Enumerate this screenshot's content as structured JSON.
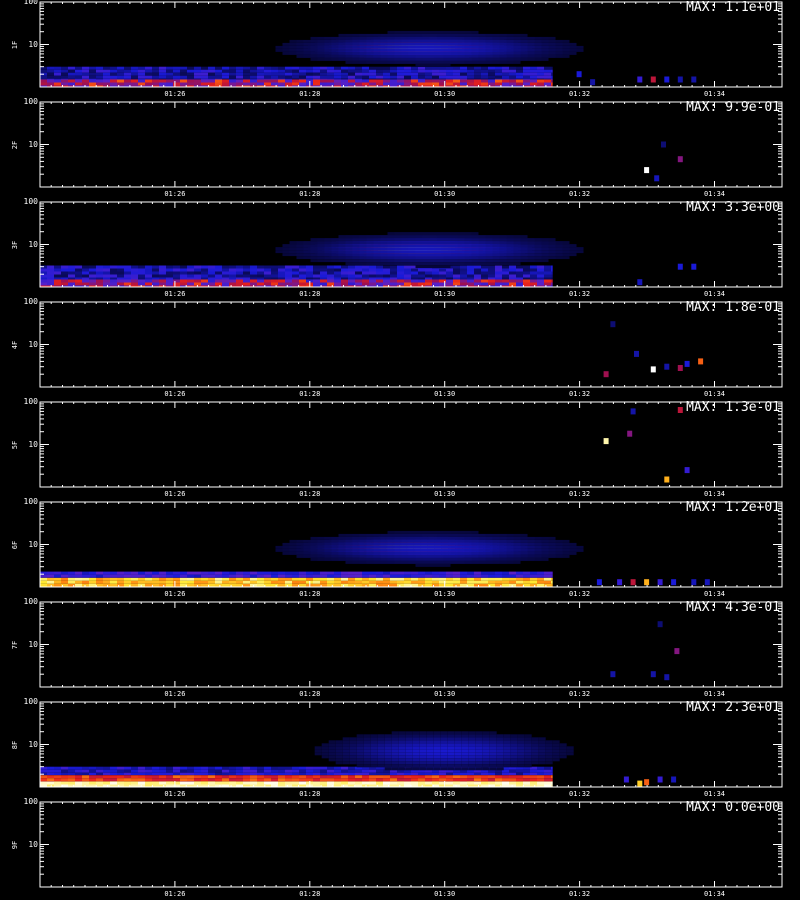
{
  "chart_data": {
    "type": "heatmap",
    "colormap": [
      "#000000",
      "#0a0a5a",
      "#1a1ad8",
      "#5a20c8",
      "#a01050",
      "#e8201a",
      "#ff8a10",
      "#ffe830",
      "#ffffff"
    ],
    "x_ticks": [
      "01:26",
      "01:28",
      "01:30",
      "01:32",
      "01:34"
    ],
    "x_range_minutes": [
      84.0,
      95.0
    ],
    "y_range": [
      1,
      100
    ],
    "y_scale": "log",
    "y_ticks": [
      "100",
      "10"
    ],
    "panels": [
      {
        "channel": "1F",
        "max_label": "MAX: 1.1e+01",
        "features": [
          {
            "kind": "band",
            "x0": 84.0,
            "x1": 91.6,
            "y0": 1.0,
            "y1": 1.5,
            "level": 0.5,
            "jitter": 0.2
          },
          {
            "kind": "band",
            "x0": 84.0,
            "x1": 91.6,
            "y0": 1.5,
            "y1": 3.0,
            "level": 0.22,
            "jitter": 0.1
          },
          {
            "kind": "blob",
            "xc": 89.6,
            "yc": 9.0,
            "sx": 0.75,
            "sy": 0.12,
            "level": 1.0
          },
          {
            "kind": "halo",
            "xc": 89.8,
            "yc": 8.0,
            "sx": 1.6,
            "sy": 0.28,
            "level": 0.22
          },
          {
            "kind": "pixels",
            "list": [
              [
                92.0,
                2.0,
                0.25
              ],
              [
                92.2,
                1.3,
                0.2
              ],
              [
                92.9,
                1.5,
                0.3
              ],
              [
                93.1,
                1.5,
                0.55
              ],
              [
                93.3,
                1.5,
                0.25
              ],
              [
                93.5,
                1.5,
                0.2
              ],
              [
                93.7,
                1.5,
                0.2
              ]
            ]
          }
        ]
      },
      {
        "channel": "2F",
        "max_label": "MAX: 9.9e-01",
        "features": [
          {
            "kind": "pixels",
            "list": [
              [
                93.0,
                2.5,
                1.0
              ],
              [
                93.15,
                1.6,
                0.22
              ],
              [
                93.5,
                4.5,
                0.45
              ],
              [
                93.25,
                10.0,
                0.15
              ]
            ]
          }
        ]
      },
      {
        "channel": "3F",
        "max_label": "MAX: 3.3e+00",
        "features": [
          {
            "kind": "band",
            "x0": 84.0,
            "x1": 91.6,
            "y0": 1.0,
            "y1": 1.5,
            "level": 0.48,
            "jitter": 0.2
          },
          {
            "kind": "band",
            "x0": 84.0,
            "x1": 91.6,
            "y0": 1.5,
            "y1": 3.2,
            "level": 0.22,
            "jitter": 0.1
          },
          {
            "kind": "blob",
            "xc": 89.6,
            "yc": 8.0,
            "sx": 0.75,
            "sy": 0.12,
            "level": 1.0
          },
          {
            "kind": "halo",
            "xc": 89.8,
            "yc": 7.5,
            "sx": 1.6,
            "sy": 0.28,
            "level": 0.22
          },
          {
            "kind": "pixels",
            "list": [
              [
                93.5,
                3.0,
                0.25
              ],
              [
                93.7,
                3.0,
                0.25
              ],
              [
                92.9,
                1.3,
                0.22
              ]
            ]
          }
        ]
      },
      {
        "channel": "4F",
        "max_label": "MAX: 1.8e-01",
        "features": [
          {
            "kind": "pixels",
            "list": [
              [
                92.4,
                2.0,
                0.5
              ],
              [
                93.1,
                2.6,
                1.0
              ],
              [
                93.5,
                2.8,
                0.5
              ],
              [
                93.8,
                4.0,
                0.7
              ],
              [
                92.85,
                6.0,
                0.2
              ],
              [
                92.5,
                30.0,
                0.15
              ],
              [
                93.3,
                3.0,
                0.2
              ],
              [
                93.6,
                3.5,
                0.25
              ]
            ]
          }
        ]
      },
      {
        "channel": "5F",
        "max_label": "MAX: 1.3e-01",
        "features": [
          {
            "kind": "pixels",
            "list": [
              [
                92.4,
                12.0,
                0.95
              ],
              [
                92.75,
                18.0,
                0.45
              ],
              [
                93.5,
                65.0,
                0.55
              ],
              [
                93.3,
                1.5,
                0.8
              ],
              [
                93.6,
                2.5,
                0.3
              ],
              [
                92.8,
                60.0,
                0.2
              ]
            ]
          }
        ]
      },
      {
        "channel": "6F",
        "max_label": "MAX: 1.2e+01",
        "features": [
          {
            "kind": "band",
            "x0": 84.0,
            "x1": 91.6,
            "y0": 1.0,
            "y1": 1.65,
            "level": 0.84,
            "jitter": 0.1
          },
          {
            "kind": "band",
            "x0": 84.0,
            "x1": 91.6,
            "y0": 1.65,
            "y1": 2.3,
            "level": 0.3,
            "jitter": 0.08
          },
          {
            "kind": "blob",
            "xc": 89.5,
            "yc": 9.0,
            "sx": 0.75,
            "sy": 0.12,
            "level": 0.95
          },
          {
            "kind": "halo",
            "xc": 89.8,
            "yc": 8.0,
            "sx": 1.6,
            "sy": 0.28,
            "level": 0.22
          },
          {
            "kind": "pixels",
            "list": [
              [
                92.3,
                1.3,
                0.25
              ],
              [
                92.6,
                1.3,
                0.3
              ],
              [
                92.8,
                1.3,
                0.55
              ],
              [
                93.0,
                1.3,
                0.8
              ],
              [
                93.2,
                1.3,
                0.3
              ],
              [
                93.4,
                1.3,
                0.25
              ],
              [
                93.7,
                1.3,
                0.22
              ],
              [
                93.9,
                1.3,
                0.22
              ]
            ]
          }
        ]
      },
      {
        "channel": "7F",
        "max_label": "MAX: 4.3e-01",
        "features": [
          {
            "kind": "pixels",
            "list": [
              [
                93.45,
                7.0,
                0.45
              ],
              [
                92.5,
                2.0,
                0.2
              ],
              [
                93.1,
                2.0,
                0.2
              ],
              [
                93.3,
                1.7,
                0.2
              ],
              [
                93.2,
                30.0,
                0.15
              ]
            ]
          }
        ]
      },
      {
        "channel": "8F",
        "max_label": "MAX: 2.3e+01",
        "features": [
          {
            "kind": "band",
            "x0": 84.0,
            "x1": 91.6,
            "y0": 1.0,
            "y1": 1.35,
            "level": 0.95,
            "jitter": 0.04
          },
          {
            "kind": "band",
            "x0": 84.0,
            "x1": 91.6,
            "y0": 1.35,
            "y1": 1.9,
            "level": 0.64,
            "jitter": 0.08
          },
          {
            "kind": "band",
            "x0": 84.0,
            "x1": 91.6,
            "y0": 1.9,
            "y1": 3.0,
            "level": 0.24,
            "jitter": 0.08
          },
          {
            "kind": "halo",
            "xc": 90.0,
            "yc": 7.0,
            "sx": 1.3,
            "sy": 0.32,
            "level": 0.24
          },
          {
            "kind": "pixels",
            "list": [
              [
                92.9,
                1.2,
                0.84
              ],
              [
                93.0,
                1.3,
                0.7
              ],
              [
                92.7,
                1.5,
                0.3
              ],
              [
                93.2,
                1.5,
                0.3
              ],
              [
                93.4,
                1.5,
                0.22
              ]
            ]
          }
        ]
      },
      {
        "channel": "9F",
        "max_label": "MAX: 0.0e+00",
        "features": []
      }
    ]
  }
}
